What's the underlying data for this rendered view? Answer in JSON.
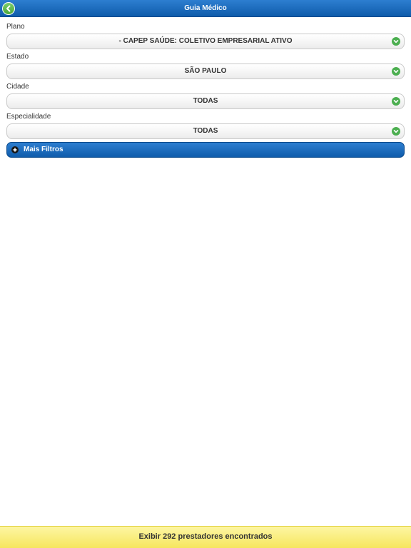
{
  "header": {
    "title": "Guia Médico",
    "back_icon": "chevron-left-icon"
  },
  "fields": [
    {
      "label": "Plano",
      "value": "- CAPEP SAÚDE: COLETIVO EMPRESARIAL ATIVO"
    },
    {
      "label": "Estado",
      "value": "SÃO PAULO"
    },
    {
      "label": "Cidade",
      "value": "TODAS"
    },
    {
      "label": "Especialidade",
      "value": "TODAS"
    }
  ],
  "filters": {
    "label": "Mais Filtros",
    "icon": "plus-icon"
  },
  "footer": {
    "button_label": "Exibir 292 prestadores encontrados"
  },
  "colors": {
    "header_blue": "#0f5cab",
    "accent_green": "#4caf50",
    "footer_yellow": "#f6e65e"
  }
}
